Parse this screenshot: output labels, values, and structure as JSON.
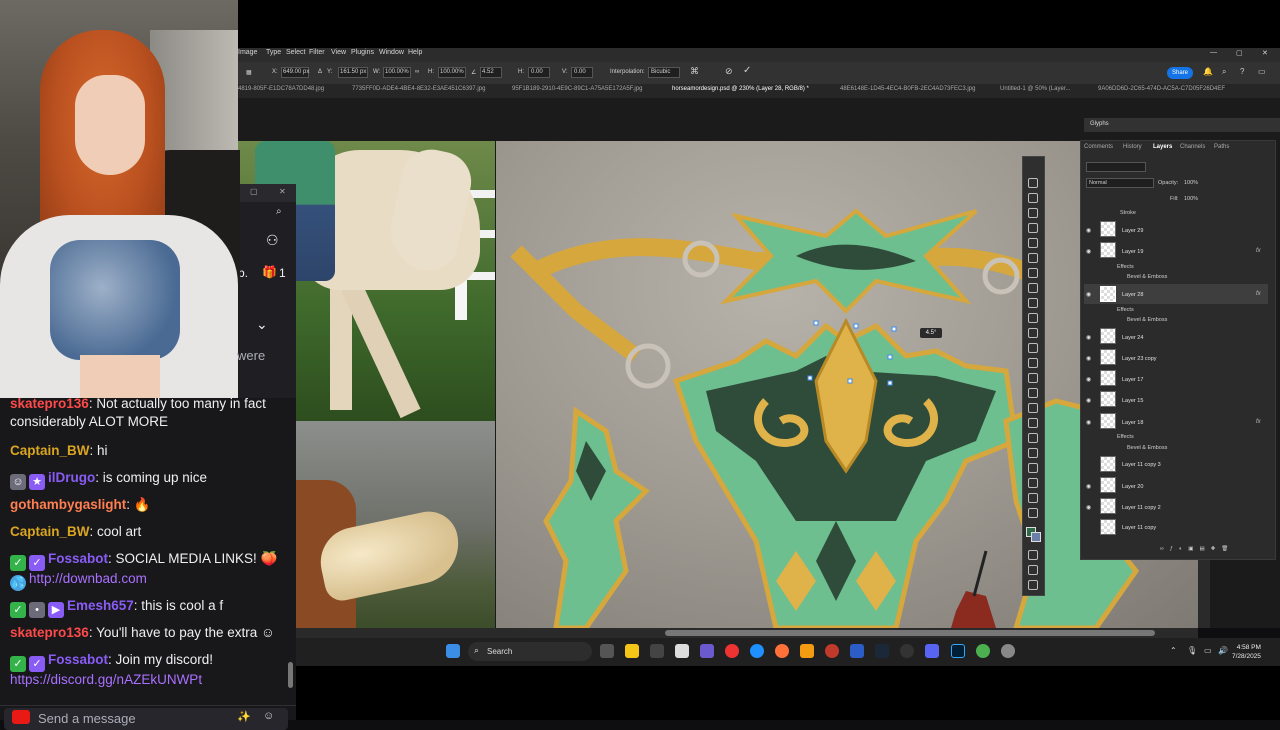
{
  "chat": {
    "partial_text": "were",
    "messages": [
      {
        "user": "skatepro136",
        "user_color": "#ff4a4a",
        "text": ": Not actually too many in fact considerably ALOT MORE"
      },
      {
        "user": "Captain_BW",
        "user_color": "#daa520",
        "text": ": hi"
      },
      {
        "user": "ilDrugo",
        "user_color": "#8a5cf6",
        "text": ": is coming up nice"
      },
      {
        "user": "gothambygaslight",
        "user_color": "#ff7f50",
        "text": ": 🔥"
      },
      {
        "user": "Captain_BW",
        "user_color": "#daa520",
        "text": ": cool art"
      },
      {
        "user": "Fossabot",
        "user_color": "#8a5cf6",
        "text": ": SOCIAL MEDIA LINKS! 🍑",
        "link": "http://downbad.com"
      },
      {
        "user": "Emesh657",
        "user_color": "#8a5cf6",
        "text": ": this is cool a f"
      },
      {
        "user": "skatepro136",
        "user_color": "#ff4a4a",
        "text": ": You'll have to pay the extra ☺"
      },
      {
        "user": "Fossabot",
        "user_color": "#8a5cf6",
        "text": ": Join my discord!",
        "link": "https://discord.gg/nAZEkUNWPt"
      }
    ],
    "input_placeholder": "Send a message",
    "side_count": "1"
  },
  "photoshop": {
    "menu": [
      "Image",
      "Type",
      "Select",
      "Filter",
      "View",
      "Plugins",
      "Window",
      "Help"
    ],
    "options": {
      "x": "649.00 px",
      "y": "161.50 px",
      "w": "100.00%",
      "h": "100.00%",
      "angle": "4.52",
      "h_skew": "0.00",
      "v_skew": "0.00",
      "interpolation_label": "Interpolation:",
      "interpolation": "Bicubic",
      "share": "Share"
    },
    "tabs": [
      "4819-805F-E1DC78A7DD48.jpg",
      "7735FF0D-ADE4-4BE4-8E32-E3AE451C6397.jpg",
      "95F1B189-2910-4E9C-89C1-A75A5E172A5F.jpg",
      "horseamordesign.psd @ 230% (Layer 28, RGB/8) *",
      "48E6148E-1D45-4EC4-B0FB-2EC4AD73FEC3.jpg",
      "Untitled-1 @ 50% (Layer...",
      "9A06DD6D-2C65-474D-AC5A-C7D05F26D4EF"
    ],
    "rotate_readout": "4.5°",
    "glyphs_title": "Glyphs",
    "panel_tabs": [
      "Comments",
      "History",
      "Layers",
      "Channels",
      "Paths"
    ],
    "blend_mode": "Normal",
    "opacity_label": "Opacity:",
    "opacity": "100%",
    "fill_label": "Fill:",
    "fill": "100%",
    "layers": [
      {
        "name": "Stroke",
        "kind": "effect"
      },
      {
        "name": "Layer 29",
        "kind": "layer"
      },
      {
        "name": "Layer 19",
        "kind": "layer",
        "fx": true
      },
      {
        "name": "Effects",
        "kind": "effect-group"
      },
      {
        "name": "Bevel & Emboss",
        "kind": "effect"
      },
      {
        "name": "Layer 28",
        "kind": "layer",
        "fx": true,
        "selected": true
      },
      {
        "name": "Effects",
        "kind": "effect-group"
      },
      {
        "name": "Bevel & Emboss",
        "kind": "effect"
      },
      {
        "name": "Layer 24",
        "kind": "layer"
      },
      {
        "name": "Layer 23 copy",
        "kind": "layer"
      },
      {
        "name": "Layer 17",
        "kind": "layer"
      },
      {
        "name": "Layer 15",
        "kind": "layer"
      },
      {
        "name": "Layer 18",
        "kind": "layer",
        "fx": true
      },
      {
        "name": "Effects",
        "kind": "effect-group"
      },
      {
        "name": "Bevel & Emboss",
        "kind": "effect"
      },
      {
        "name": "Layer 11 copy 3",
        "kind": "layer"
      },
      {
        "name": "Layer 20",
        "kind": "layer"
      },
      {
        "name": "Layer 11 copy 2",
        "kind": "layer"
      },
      {
        "name": "Layer 11 copy",
        "kind": "layer"
      }
    ]
  },
  "taskbar": {
    "search": "Search",
    "time": "4:58 PM",
    "date": "7/28/2025"
  },
  "colors": {
    "twitch_purple": "#a970ff",
    "armor_green": "#6dbf8f",
    "armor_dark": "#2f4b3a",
    "armor_gold": "#d6a73c",
    "ps_accent": "#1473e6"
  }
}
